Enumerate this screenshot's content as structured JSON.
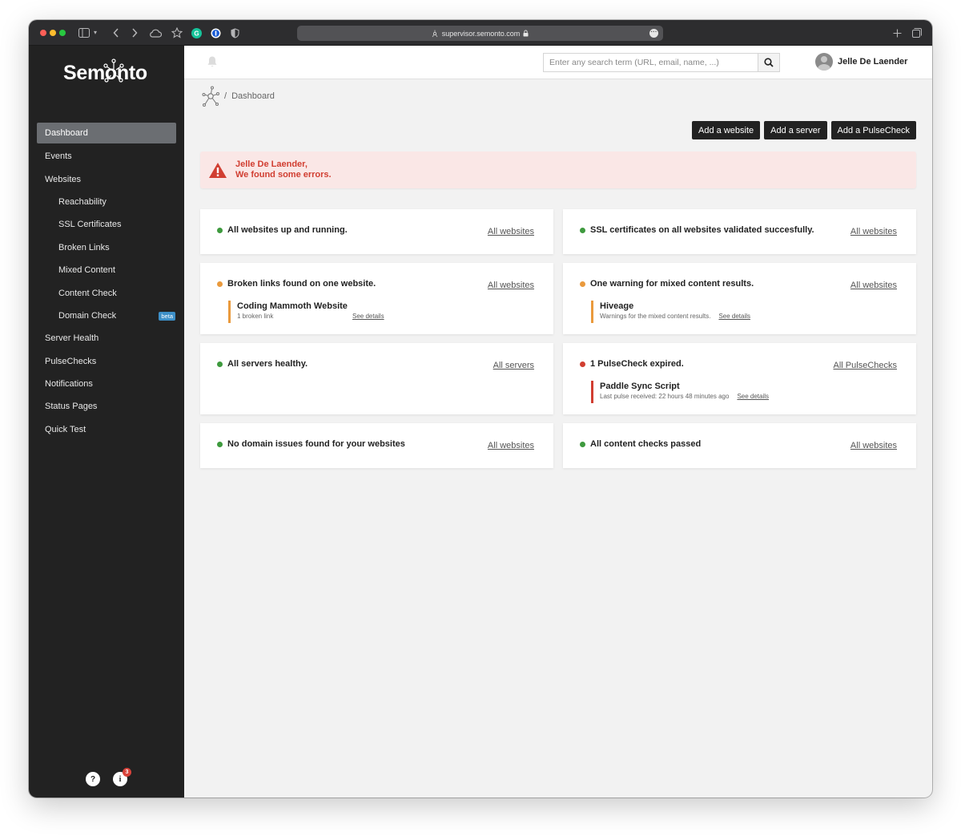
{
  "browser": {
    "url": "supervisor.semonto.com"
  },
  "logo": {
    "text": "Semonto"
  },
  "sidebar": {
    "items": [
      {
        "label": "Dashboard"
      },
      {
        "label": "Events"
      },
      {
        "label": "Websites"
      },
      {
        "label": "Reachability"
      },
      {
        "label": "SSL Certificates"
      },
      {
        "label": "Broken Links"
      },
      {
        "label": "Mixed Content"
      },
      {
        "label": "Content Check"
      },
      {
        "label": "Domain Check",
        "badge": "beta"
      },
      {
        "label": "Server Health"
      },
      {
        "label": "PulseChecks"
      },
      {
        "label": "Notifications"
      },
      {
        "label": "Status Pages"
      },
      {
        "label": "Quick Test"
      }
    ],
    "help_label": "?",
    "info_label": "i",
    "info_count": "3"
  },
  "header": {
    "search_placeholder": "Enter any search term (URL, email, name, ...)",
    "user_name": "Jelle De Laender"
  },
  "breadcrumb": {
    "separator": "/",
    "current": "Dashboard"
  },
  "actions": {
    "add_website": "Add a website",
    "add_server": "Add a server",
    "add_pulsecheck": "Add a PulseCheck"
  },
  "alert": {
    "line1": "Jelle De Laender,",
    "line2": "We found some errors."
  },
  "cards": {
    "reachability": {
      "status": "All websites up and running.",
      "link": "All websites"
    },
    "ssl": {
      "status": "SSL certificates on all websites validated succesfully.",
      "link": "All websites"
    },
    "broken_links": {
      "status": "Broken links found on one website.",
      "link": "All websites",
      "item_title": "Coding Mammoth Website",
      "item_desc": "1 broken link",
      "item_link": "See details"
    },
    "mixed_content": {
      "status": "One warning for mixed content results.",
      "link": "All websites",
      "item_title": "Hiveage",
      "item_desc": "Warnings for the mixed content results.",
      "item_link": "See details"
    },
    "servers": {
      "status": "All servers healthy.",
      "link": "All servers"
    },
    "pulsecheck": {
      "status": "1 PulseCheck expired.",
      "link": "All PulseChecks",
      "item_title": "Paddle Sync Script",
      "item_desc": "Last pulse received: 22 hours 48 minutes ago",
      "item_link": "See details"
    },
    "domain": {
      "status": "No domain issues found for your websites",
      "link": "All websites"
    },
    "content": {
      "status": "All content checks passed",
      "link": "All websites"
    }
  },
  "colors": {
    "sidebar_bg": "#222222",
    "ok": "#3e9a3e",
    "warning": "#ea9a3d",
    "error": "#d13e31",
    "alert_bg": "#fae7e6"
  }
}
